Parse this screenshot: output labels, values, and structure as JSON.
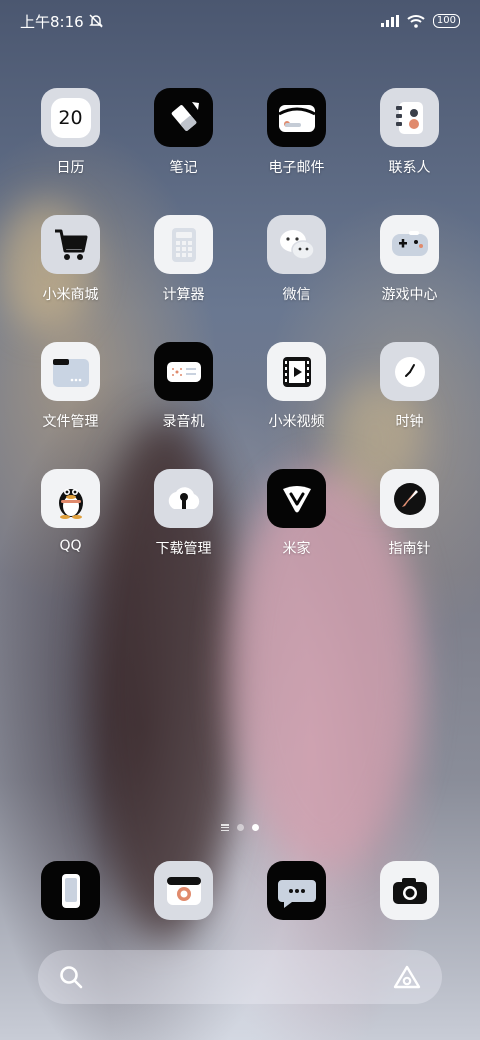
{
  "status_bar": {
    "time": "上午8:16",
    "battery": "100"
  },
  "apps": [
    {
      "label": "日历",
      "icon": "calendar-icon",
      "date": "20"
    },
    {
      "label": "笔记",
      "icon": "notes-icon"
    },
    {
      "label": "电子邮件",
      "icon": "email-icon"
    },
    {
      "label": "联系人",
      "icon": "contacts-icon"
    },
    {
      "label": "小米商城",
      "icon": "shopping-cart-icon"
    },
    {
      "label": "计算器",
      "icon": "calculator-icon"
    },
    {
      "label": "微信",
      "icon": "wechat-icon"
    },
    {
      "label": "游戏中心",
      "icon": "gamepad-icon"
    },
    {
      "label": "文件管理",
      "icon": "folder-icon"
    },
    {
      "label": "录音机",
      "icon": "recorder-icon"
    },
    {
      "label": "小米视频",
      "icon": "video-icon"
    },
    {
      "label": "时钟",
      "icon": "clock-icon"
    },
    {
      "label": "QQ",
      "icon": "qq-penguin-icon"
    },
    {
      "label": "下载管理",
      "icon": "download-icon"
    },
    {
      "label": "米家",
      "icon": "mijia-icon"
    },
    {
      "label": "指南针",
      "icon": "compass-icon"
    }
  ],
  "dock": [
    {
      "name": "phone",
      "icon": "phone-icon"
    },
    {
      "name": "gallery",
      "icon": "gallery-icon"
    },
    {
      "name": "messages",
      "icon": "message-icon"
    },
    {
      "name": "camera",
      "icon": "camera-icon"
    }
  ],
  "page_indicator": {
    "count": 2,
    "active": 2
  },
  "colors": {
    "icon_light": "#f2f3f5",
    "icon_gray": "#d9dce3",
    "icon_dark": "#050505"
  }
}
